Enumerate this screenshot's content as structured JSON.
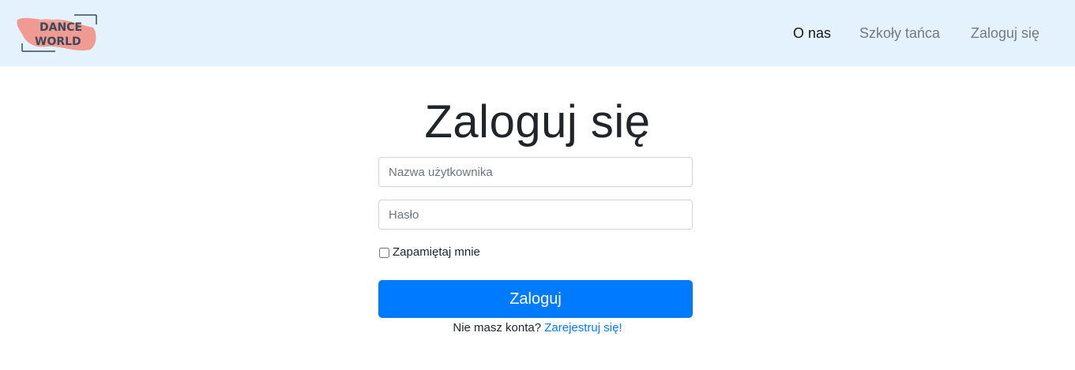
{
  "brand": {
    "logo_line1": "DANCE",
    "logo_line2": "WORLD",
    "accent": "#f28b7e"
  },
  "nav": {
    "items": [
      {
        "label": "O nas",
        "active": true
      },
      {
        "label": "Szkoły tańca",
        "active": false
      },
      {
        "label": "Zaloguj się",
        "active": false
      }
    ]
  },
  "login": {
    "title": "Zaloguj się",
    "username_placeholder": "Nazwa użytkownika",
    "username_value": "",
    "password_placeholder": "Hasło",
    "password_value": "",
    "remember_label": "Zapamiętaj mnie",
    "remember_checked": false,
    "submit_label": "Zaloguj",
    "no_account_text": "Nie masz konta?",
    "register_link": "Zarejestruj się!"
  },
  "colors": {
    "navbar_bg": "#e3f2fd",
    "primary": "#007bff"
  }
}
